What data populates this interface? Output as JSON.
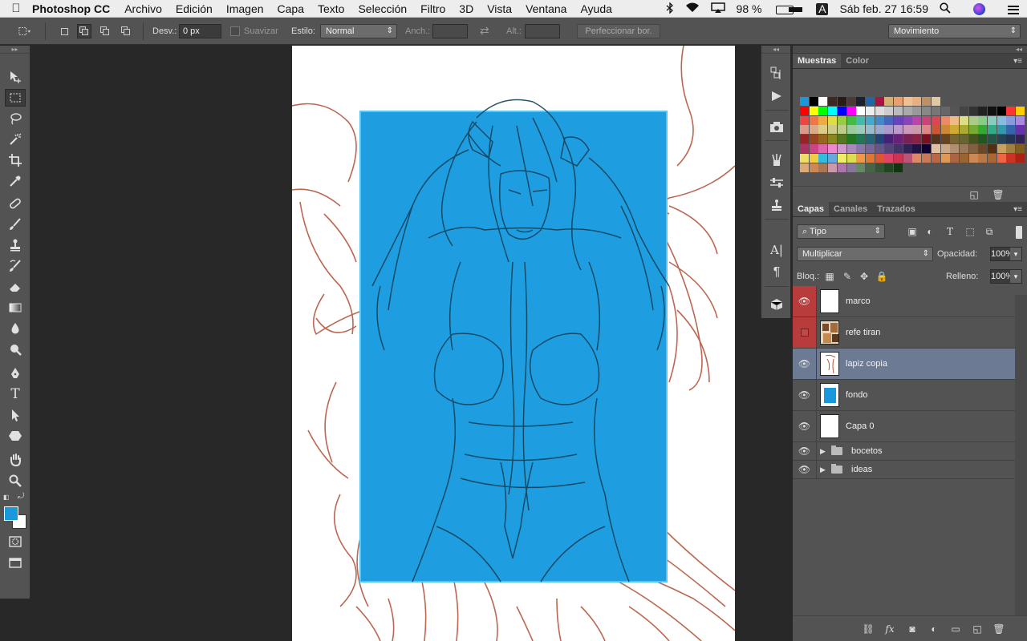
{
  "menubar": {
    "app_name": "Photoshop CC",
    "items": [
      "Archivo",
      "Edición",
      "Imagen",
      "Capa",
      "Texto",
      "Selección",
      "Filtro",
      "3D",
      "Vista",
      "Ventana",
      "Ayuda"
    ],
    "battery": "98 %",
    "input_source": "A",
    "clock": "Sáb feb. 27  16:59"
  },
  "options_bar": {
    "feather_label": "Desv.:",
    "feather_value": "0 px",
    "antialias_label": "Suavizar",
    "style_label": "Estilo:",
    "style_value": "Normal",
    "width_label": "Anch.:",
    "height_label": "Alt.:",
    "refine_edge_label": "Perfeccionar bor.",
    "workspace_value": "Movimiento"
  },
  "swatches_panel": {
    "tabs": [
      "Muestras",
      "Color"
    ]
  },
  "layers_panel": {
    "tabs": [
      "Capas",
      "Canales",
      "Trazados"
    ],
    "filter_value": "Tipo",
    "blend_mode": "Multiplicar",
    "opacity_label": "Opacidad:",
    "opacity_value": "100%",
    "lock_label": "Bloq.:",
    "fill_label": "Relleno:",
    "fill_value": "100%",
    "layers": [
      {
        "name": "marco"
      },
      {
        "name": "refe tiran"
      },
      {
        "name": "lapiz copia"
      },
      {
        "name": "fondo"
      },
      {
        "name": "Capa 0"
      }
    ],
    "groups": [
      {
        "name": "bocetos"
      },
      {
        "name": "ideas"
      }
    ]
  },
  "colors": {
    "foreground": "#1b98dc",
    "background": "#ffffff",
    "selection_fill": "#1e9ee0",
    "sketch_red": "#b5573f",
    "sketch_dark": "#12425a",
    "selected_layer": "#6c7a94"
  }
}
